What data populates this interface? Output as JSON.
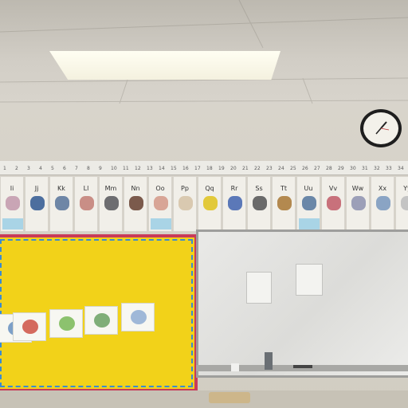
{
  "number_line": {
    "numbers": [
      "1",
      "2",
      "3",
      "4",
      "5",
      "6",
      "7",
      "8",
      "9",
      "10",
      "11",
      "12",
      "13",
      "14",
      "15",
      "16",
      "17",
      "18",
      "19",
      "20",
      "21",
      "22",
      "23",
      "24",
      "25",
      "26",
      "27",
      "28",
      "29",
      "30",
      "31",
      "32",
      "33",
      "34"
    ]
  },
  "alphabet_cards": [
    {
      "label": "Ii",
      "pic": "#c9a5b5",
      "tag": true
    },
    {
      "label": "Jj",
      "pic": "#4c6e9e",
      "tag": false
    },
    {
      "label": "Kk",
      "pic": "#6e86a6",
      "tag": false
    },
    {
      "label": "Ll",
      "pic": "#c98e86",
      "tag": false
    },
    {
      "label": "Mm",
      "pic": "#6d6d70",
      "tag": false
    },
    {
      "label": "Nn",
      "pic": "#7b5a4c",
      "tag": false
    },
    {
      "label": "Oo",
      "pic": "#d8a596",
      "tag": true
    },
    {
      "label": "Pp",
      "pic": "#d9c9b0",
      "tag": false
    },
    {
      "label": "Qq",
      "pic": "#e2c93a",
      "tag": false
    },
    {
      "label": "Rr",
      "pic": "#5b78b8",
      "tag": false
    },
    {
      "label": "Ss",
      "pic": "#6a6a6a",
      "tag": false
    },
    {
      "label": "Tt",
      "pic": "#b3894f",
      "tag": false
    },
    {
      "label": "Uu",
      "pic": "#6a87a8",
      "tag": true
    },
    {
      "label": "Vv",
      "pic": "#c8717b",
      "tag": false
    },
    {
      "label": "Ww",
      "pic": "#9c9fb8",
      "tag": false
    },
    {
      "label": "Xx",
      "pic": "#8aa4c4",
      "tag": false
    },
    {
      "label": "Yy",
      "pic": "#c4c4c4",
      "tag": false
    }
  ],
  "colors": {
    "bulletin_board": "#f2d219",
    "border_red": "#c83b5a",
    "whiteboard": "#e6e6e3"
  },
  "icons": {
    "clock": "wall-clock-icon"
  }
}
